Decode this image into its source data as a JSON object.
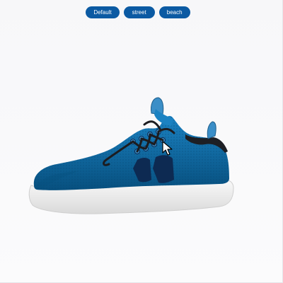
{
  "toolbar": {
    "presets": [
      {
        "label": "Default"
      },
      {
        "label": "street"
      },
      {
        "label": "beach"
      }
    ]
  },
  "colors": {
    "button": "#0b5aa3",
    "shoe_upper": "#0a6aa8",
    "shoe_upper_dark": "#07507f",
    "stripe": "#0d2a52",
    "collar": "#1d1f24",
    "pull_tab": "#3b8ec7",
    "sole": "#ededed",
    "laces": "#1c1c20"
  },
  "icons": {
    "cursor": "mouse-pointer-icon"
  }
}
